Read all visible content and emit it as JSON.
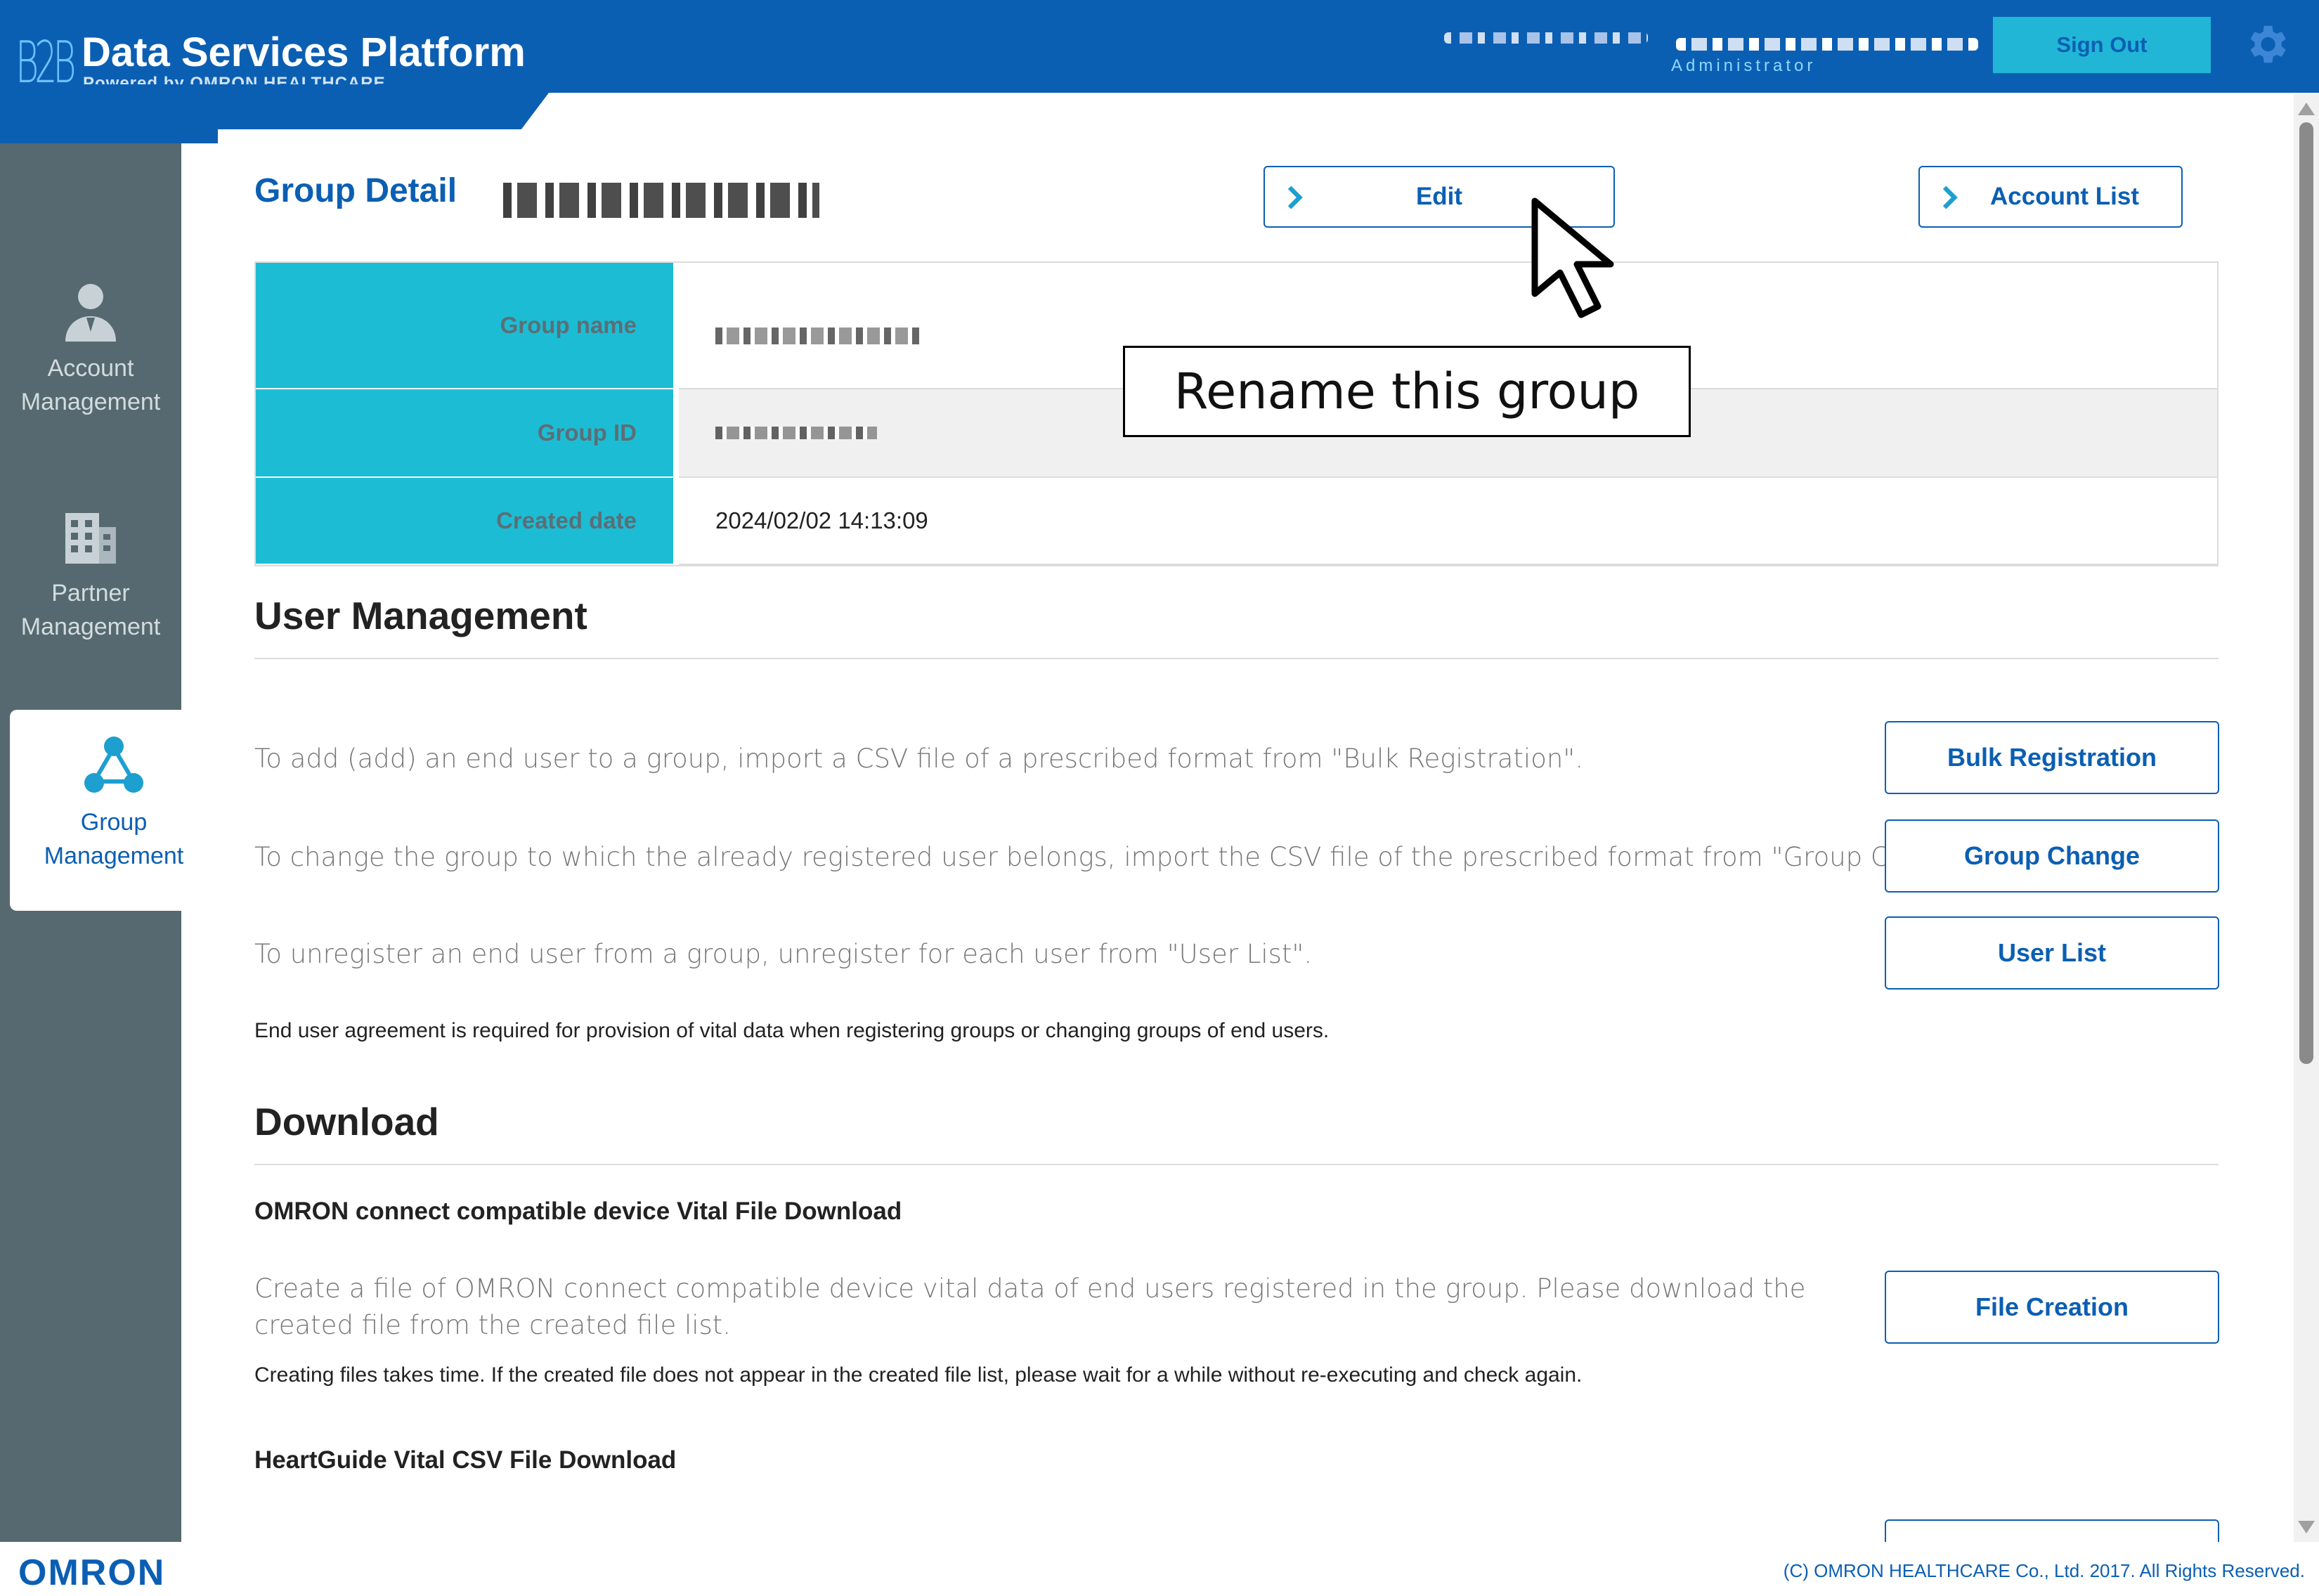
{
  "header": {
    "logo_text": "B2B",
    "title": "Data Services Platform",
    "subtitle": "Powered by OMRON HEALTHCARE",
    "user_role": "Administrator",
    "sign_out_label": "Sign Out",
    "settings_icon": "gear-icon",
    "bg_color": "#0b5fb3",
    "accent_color": "#21b6d6"
  },
  "sidebar": {
    "items": [
      {
        "label": "Account\nManagement",
        "icon": "person-icon"
      },
      {
        "label": "Partner\nManagement",
        "icon": "building-icon"
      },
      {
        "label": "Group\nManagement",
        "icon": "group-icon",
        "active": true
      }
    ],
    "bg_color": "#566970"
  },
  "page": {
    "title": "Group Detail",
    "edit_label": "Edit",
    "account_list_label": "Account List"
  },
  "details": {
    "rows": [
      {
        "label": "Group name",
        "value": ""
      },
      {
        "label": "Group ID",
        "value": ""
      },
      {
        "label": "Created date",
        "value": "2024/02/02 14:13:09"
      }
    ],
    "label_bg": "#1cbdd4"
  },
  "user_management": {
    "heading": "User Management",
    "add_text": "To add (add) an end user to a group, import a CSV file of a prescribed format from \"Bulk Registration\".",
    "change_text": "To change the group to which the already registered user belongs, import the CSV file of the prescribed format from \"Group Change\".",
    "unregister_text": "To unregister an end user from a group, unregister for each user from \"User List\".",
    "note": "End user agreement is required for provision of vital data when registering groups or changing groups of end users.",
    "bulk_label": "Bulk Registration",
    "group_change_label": "Group Change",
    "user_list_label": "User List"
  },
  "download": {
    "heading": "Download",
    "omron_heading": "OMRON connect compatible device Vital File Download",
    "omron_text": "Create a file of OMRON connect compatible device vital data of end users registered in the group. Please download the created file from the created file list.",
    "omron_note": "Creating files takes time. If the created file does not appear in the created file list, please wait for a while without re-executing and check again.",
    "file_creation_label": "File Creation",
    "heartguide_heading": "HeartGuide Vital CSV File Download"
  },
  "footer": {
    "logo": "OMRON",
    "copyright": "(C) OMRON HEALTHCARE Co., Ltd. 2017. All Rights Reserved."
  },
  "annotation": {
    "callout": "Rename this group"
  }
}
